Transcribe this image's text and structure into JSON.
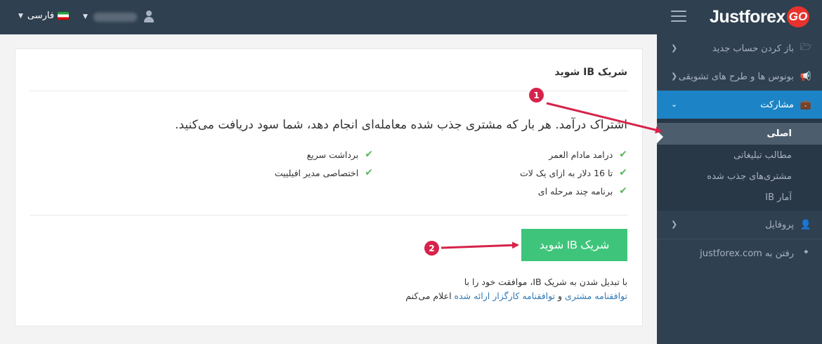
{
  "topbar": {
    "logo_text": "Justforex",
    "logo_badge": "GO",
    "language": "فارسی",
    "hamburger_icon": "menu-icon",
    "user_icon": "user-icon"
  },
  "sidebar": {
    "items": [
      {
        "label": "باز کردن حساب جدید",
        "icon": "folder-icon"
      },
      {
        "label": "بونوس ها و طرح های تشویقی",
        "icon": "megaphone-icon"
      },
      {
        "label": "مشارکت",
        "icon": "briefcase-icon"
      },
      {
        "label": "پروفایل",
        "icon": "user-icon"
      },
      {
        "label": "رفتن به justforex.com",
        "icon": "arrow-left-icon"
      }
    ],
    "submenu": [
      {
        "label": "اصلی"
      },
      {
        "label": "مطالب تبلیغاتی"
      },
      {
        "label": "مشتری‌های جذب شده"
      },
      {
        "label": "آمار IB"
      }
    ]
  },
  "main": {
    "title": "شریک IB شوید",
    "lead": "اشتراک درآمد. هر بار که مشتری جذب شده معامله‌ای انجام دهد، شما سود دریافت می‌کنید.",
    "features_right": [
      "درامد مادام العمر",
      "تا 16 دلار به ازای یک لات",
      "برنامه چند مرحله ای"
    ],
    "features_left": [
      "برداشت سریع",
      "اختصاصی مدیر افیلییت"
    ],
    "cta_label": "شریک IB شوید",
    "terms_line1": "با تبدیل شدن به شریک IB، موافقت خود را با",
    "terms_link1": "توافقنامه مشتری",
    "terms_and": " و ",
    "terms_link2": "توافقنامه کارگزار ارائه شده",
    "terms_end": " اعلام می‌کنم"
  },
  "annotations": {
    "badge1": "1",
    "badge2": "2",
    "color": "#d6234a"
  },
  "colors": {
    "topbar": "#2f4050",
    "active": "#1c84c6",
    "cta": "#3ec57b",
    "link": "#337ab7",
    "check": "#5cb85c"
  }
}
